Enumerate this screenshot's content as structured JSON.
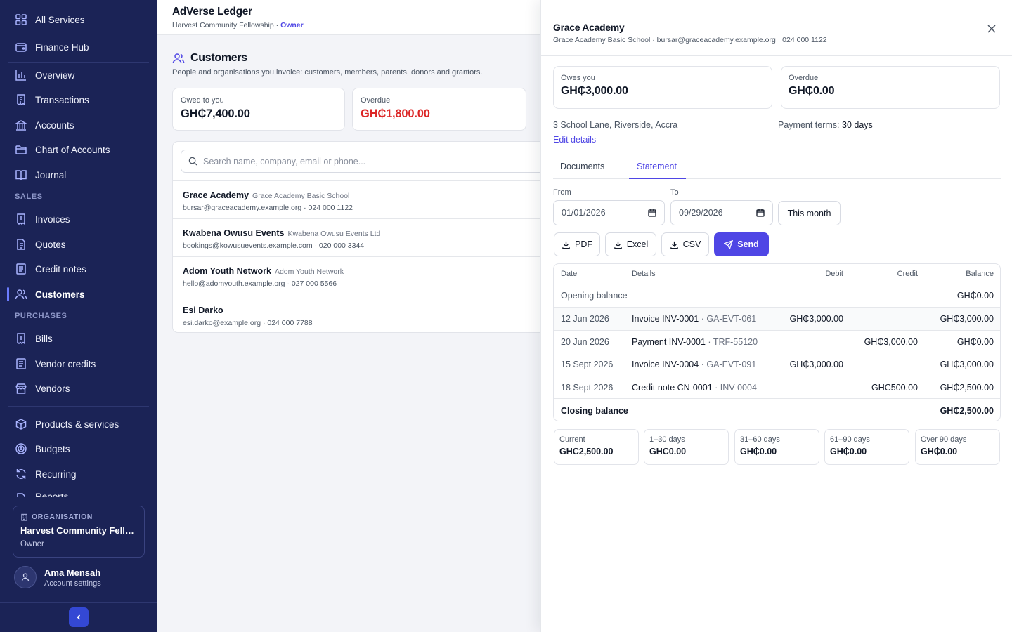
{
  "sidebar": {
    "top_items": [
      {
        "label": "All Services",
        "icon": "grid-icon"
      },
      {
        "label": "Finance Hub",
        "icon": "wallet-icon"
      }
    ],
    "main_items": [
      {
        "label": "Overview",
        "icon": "bar-chart-icon"
      },
      {
        "label": "Transactions",
        "icon": "receipt-icon"
      },
      {
        "label": "Accounts",
        "icon": "bank-icon"
      },
      {
        "label": "Chart of Accounts",
        "icon": "folder-icon"
      },
      {
        "label": "Journal",
        "icon": "book-icon"
      }
    ],
    "sales_heading": "SALES",
    "sales_items": [
      {
        "label": "Invoices",
        "icon": "invoice-icon"
      },
      {
        "label": "Quotes",
        "icon": "document-icon"
      },
      {
        "label": "Credit notes",
        "icon": "credit-note-icon"
      },
      {
        "label": "Customers",
        "icon": "users-icon",
        "active": true
      }
    ],
    "purchases_heading": "PURCHASES",
    "purchases_items": [
      {
        "label": "Bills",
        "icon": "bill-icon"
      },
      {
        "label": "Vendor credits",
        "icon": "document-icon"
      },
      {
        "label": "Vendors",
        "icon": "store-icon"
      }
    ],
    "more_items": [
      {
        "label": "Products & services",
        "icon": "box-icon"
      },
      {
        "label": "Budgets",
        "icon": "target-icon"
      },
      {
        "label": "Recurring",
        "icon": "refresh-icon"
      },
      {
        "label": "Reports",
        "icon": "report-icon"
      }
    ],
    "org": {
      "label": "ORGANISATION",
      "name": "Harvest Community Fello...",
      "role": "Owner"
    },
    "user": {
      "name": "Ama Mensah",
      "sub": "Account settings"
    }
  },
  "header": {
    "app_title": "AdVerse Ledger",
    "org_name": "Harvest Community Fellowship",
    "separator": " · ",
    "role": "Owner"
  },
  "customers_page": {
    "title": "Customers",
    "description": "People and organisations you invoice: customers, members, parents, donors and grantors.",
    "owed_label": "Owed to you",
    "owed_value": "GH₵7,400.00",
    "overdue_label": "Overdue",
    "overdue_value": "GH₵1,800.00",
    "search_placeholder": "Search name, company, email or phone...",
    "customers": [
      {
        "name": "Grace Academy",
        "company": "Grace Academy Basic School",
        "contact": "bursar@graceacademy.example.org · 024 000 1122"
      },
      {
        "name": "Kwabena Owusu Events",
        "company": "Kwabena Owusu Events Ltd",
        "contact": "bookings@kowusuevents.example.com · 020 000 3344"
      },
      {
        "name": "Adom Youth Network",
        "company": "Adom Youth Network",
        "contact": "hello@adomyouth.example.org · 027 000 5566"
      },
      {
        "name": "Esi Darko",
        "company": "",
        "contact": "esi.darko@example.org · 024 000 7788"
      }
    ]
  },
  "panel": {
    "title": "Grace Academy",
    "subtitle": "Grace Academy Basic School · bursar@graceacademy.example.org · 024 000 1122",
    "owes_label": "Owes you",
    "owes_value": "GH₵3,000.00",
    "overdue_label": "Overdue",
    "overdue_value": "GH₵0.00",
    "address": "3 School Lane, Riverside, Accra",
    "terms_label": "Payment terms:",
    "terms_value": "30 days",
    "edit_label": "Edit details",
    "tabs": [
      "Documents",
      "Statement"
    ],
    "active_tab": "Statement",
    "from_label": "From",
    "from_value": "01/01/2026",
    "to_label": "To",
    "to_value": "09/29/2026",
    "this_month": "This month",
    "export_buttons": [
      "PDF",
      "Excel",
      "CSV"
    ],
    "send_label": "Send",
    "statement": {
      "columns": [
        "Date",
        "Details",
        "Debit",
        "Credit",
        "Balance"
      ],
      "opening_label": "Opening balance",
      "opening_balance": "GH₵0.00",
      "rows": [
        {
          "date": "12 Jun 2026",
          "details": "Invoice INV-0001",
          "ref": "GA-EVT-061",
          "debit": "GH₵3,000.00",
          "credit": "",
          "balance": "GH₵3,000.00"
        },
        {
          "date": "20 Jun 2026",
          "details": "Payment INV-0001",
          "ref": "TRF-55120",
          "debit": "",
          "credit": "GH₵3,000.00",
          "balance": "GH₵0.00"
        },
        {
          "date": "15 Sept 2026",
          "details": "Invoice INV-0004",
          "ref": "GA-EVT-091",
          "debit": "GH₵3,000.00",
          "credit": "",
          "balance": "GH₵3,000.00"
        },
        {
          "date": "18 Sept 2026",
          "details": "Credit note CN-0001",
          "ref": "INV-0004",
          "debit": "",
          "credit": "GH₵500.00",
          "balance": "GH₵2,500.00"
        }
      ],
      "closing_label": "Closing balance",
      "closing_balance": "GH₵2,500.00"
    },
    "aging": [
      {
        "label": "Current",
        "value": "GH₵2,500.00"
      },
      {
        "label": "1–30 days",
        "value": "GH₵0.00"
      },
      {
        "label": "31–60 days",
        "value": "GH₵0.00"
      },
      {
        "label": "61–90 days",
        "value": "GH₵0.00"
      },
      {
        "label": "Over 90 days",
        "value": "GH₵0.00"
      }
    ]
  },
  "colors": {
    "sidebar_bg": "#1b2356",
    "accent": "#4f46e5",
    "overdue": "#dc2626"
  }
}
